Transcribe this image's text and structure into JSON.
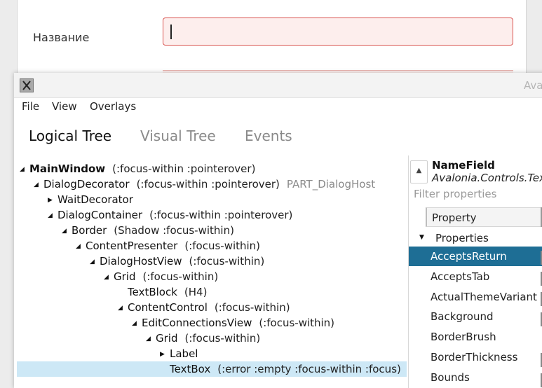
{
  "background_app": {
    "field_label": "Название"
  },
  "devtools": {
    "title": "Ava",
    "icon": "avalonia-x-icon",
    "menu": [
      "File",
      "View",
      "Overlays"
    ],
    "tabs": [
      "Logical Tree",
      "Visual Tree",
      "Events"
    ],
    "active_tab": 0,
    "tree": [
      {
        "depth": 0,
        "expander": "expanded",
        "name": "MainWindow",
        "bold": true,
        "classes": "(:focus-within :pointerover)",
        "part": ""
      },
      {
        "depth": 1,
        "expander": "expanded",
        "name": "DialogDecorator",
        "bold": false,
        "classes": "(:focus-within :pointerover)",
        "part": "PART_DialogHost"
      },
      {
        "depth": 2,
        "expander": "collapsed",
        "name": "WaitDecorator",
        "bold": false,
        "classes": "",
        "part": ""
      },
      {
        "depth": 2,
        "expander": "expanded",
        "name": "DialogContainer",
        "bold": false,
        "classes": "(:focus-within :pointerover)",
        "part": ""
      },
      {
        "depth": 3,
        "expander": "expanded",
        "name": "Border",
        "bold": false,
        "classes": "(Shadow :focus-within)",
        "part": ""
      },
      {
        "depth": 4,
        "expander": "expanded",
        "name": "ContentPresenter",
        "bold": false,
        "classes": "(:focus-within)",
        "part": ""
      },
      {
        "depth": 5,
        "expander": "expanded",
        "name": "DialogHostView",
        "bold": false,
        "classes": "(:focus-within)",
        "part": ""
      },
      {
        "depth": 6,
        "expander": "expanded",
        "name": "Grid",
        "bold": false,
        "classes": "(:focus-within)",
        "part": ""
      },
      {
        "depth": 7,
        "expander": "none",
        "name": "TextBlock",
        "bold": false,
        "classes": "(H4)",
        "part": ""
      },
      {
        "depth": 7,
        "expander": "expanded",
        "name": "ContentControl",
        "bold": false,
        "classes": "(:focus-within)",
        "part": ""
      },
      {
        "depth": 8,
        "expander": "expanded",
        "name": "EditConnectionsView",
        "bold": false,
        "classes": "(:focus-within)",
        "part": ""
      },
      {
        "depth": 9,
        "expander": "expanded",
        "name": "Grid",
        "bold": false,
        "classes": "(:focus-within)",
        "part": ""
      },
      {
        "depth": 10,
        "expander": "collapsed",
        "name": "Label",
        "bold": false,
        "classes": "",
        "part": ""
      },
      {
        "depth": 10,
        "expander": "none",
        "name": "TextBox",
        "bold": false,
        "classes": "(:error :empty :focus-within :focus)",
        "part": "",
        "selected": true
      }
    ],
    "properties": {
      "selected_name": "NameField",
      "selected_type": "Avalonia.Controls.TextBox",
      "filter_placeholder": "Filter properties",
      "column_header": "Property",
      "group_label": "Properties",
      "rows": [
        "AcceptsReturn",
        "AcceptsTab",
        "ActualThemeVariant",
        "Background",
        "BorderBrush",
        "BorderThickness",
        "Bounds"
      ],
      "selected_row": 0
    }
  },
  "colors": {
    "selected_tree_row": "#cde8f6",
    "selected_property_row": "#1e6e95",
    "error_border": "#d9534f",
    "error_fill": "#fdeeed"
  }
}
